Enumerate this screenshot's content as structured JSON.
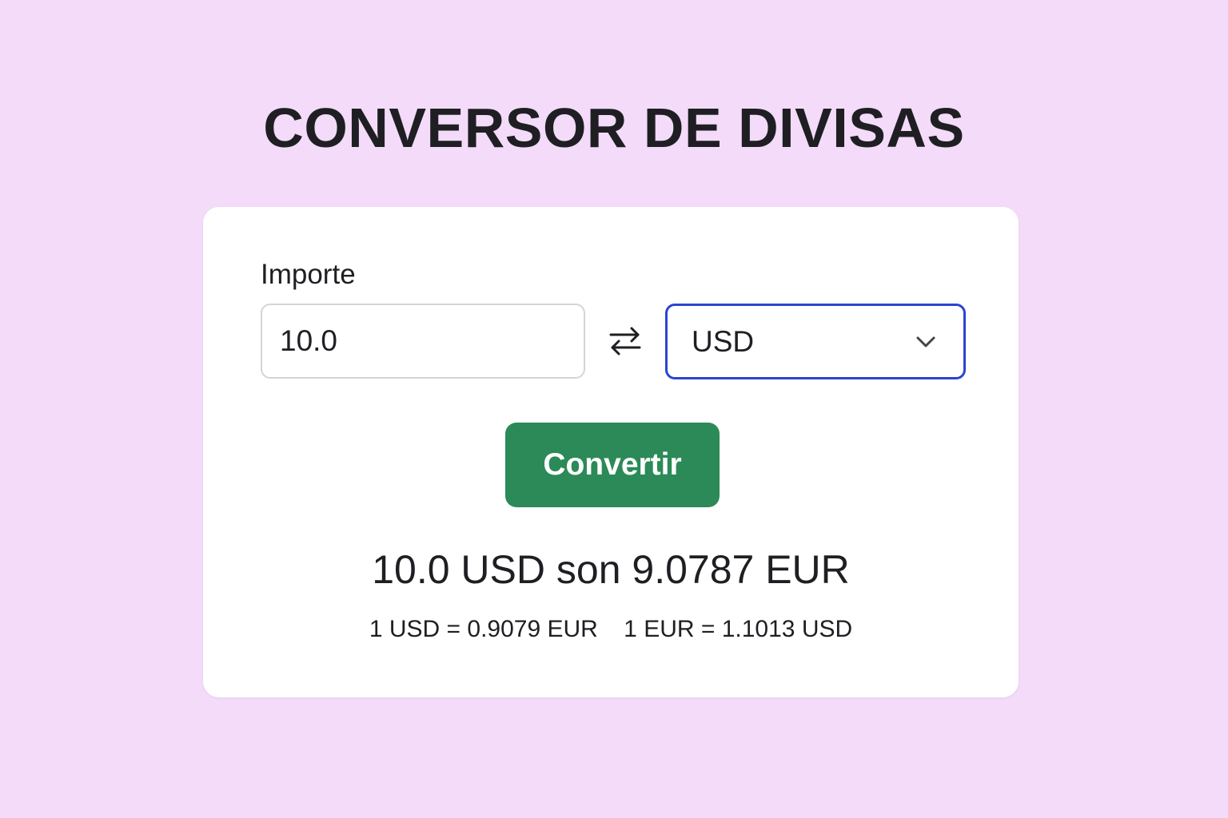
{
  "title": "CONVERSOR DE DIVISAS",
  "form": {
    "amount_label": "Importe",
    "amount_value": "10.0",
    "currency_selected": "USD",
    "swap_icon": "swap-arrows-icon",
    "chevron_icon": "chevron-down-icon",
    "convert_label": "Convertir"
  },
  "result": {
    "text": "10.0 USD son 9.0787 EUR",
    "rate_usd_eur": "1 USD = 0.9079 EUR",
    "rate_eur_usd": "1 EUR = 1.1013 USD"
  },
  "colors": {
    "background": "#f3dbf9",
    "card": "#ffffff",
    "accent_border": "#2a44d4",
    "button": "#2b8a57",
    "text": "#1f1f23"
  }
}
